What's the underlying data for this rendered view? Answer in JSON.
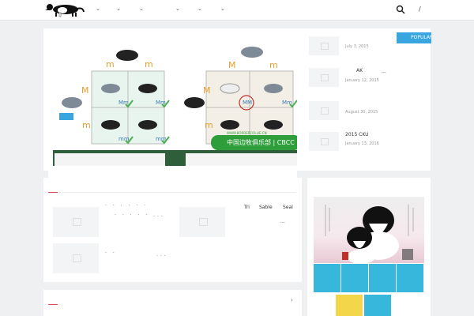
{
  "header": {
    "nav_chevrons": [
      "⌄",
      "⌄",
      "⌄",
      "⌄",
      "⌄",
      "⌄"
    ],
    "search_icon": "search-icon",
    "slash": "/"
  },
  "hero": {
    "labels_top": [
      "m",
      "m",
      "M",
      "m"
    ],
    "labels_side": [
      "M",
      "m",
      "M",
      "m"
    ],
    "cell_labels": [
      "Mm",
      "mm",
      "Mm",
      "mm",
      "MM",
      "Mm",
      "mm",
      "mm"
    ],
    "banner_text": "中国边牧俱乐部 | CBCC",
    "banner_url": "WWW.BORDERCOLLIE.CN"
  },
  "popular": {
    "button_label": "POPULAR",
    "items": [
      {
        "title": "",
        "date": "July 3, 2015"
      },
      {
        "title": "AK",
        "suffix": "...",
        "date": "January 12, 2015"
      },
      {
        "title": "",
        "date": "August 30, 2015"
      },
      {
        "title": "2015 CKU",
        "date": "January 13, 2016"
      }
    ]
  },
  "posts": {
    "rows": [
      {
        "dots": "· · · · · ·",
        "dots2": "· · · · · ..."
      },
      {
        "dots": "· ·",
        "dots2": "..."
      }
    ],
    "tags": [
      "Tri",
      "Sable",
      "Seal"
    ],
    "ellipsis": "..."
  },
  "colors": {
    "accent": "#3aa6df",
    "red": "#e04848",
    "green": "#2e9e3b"
  }
}
